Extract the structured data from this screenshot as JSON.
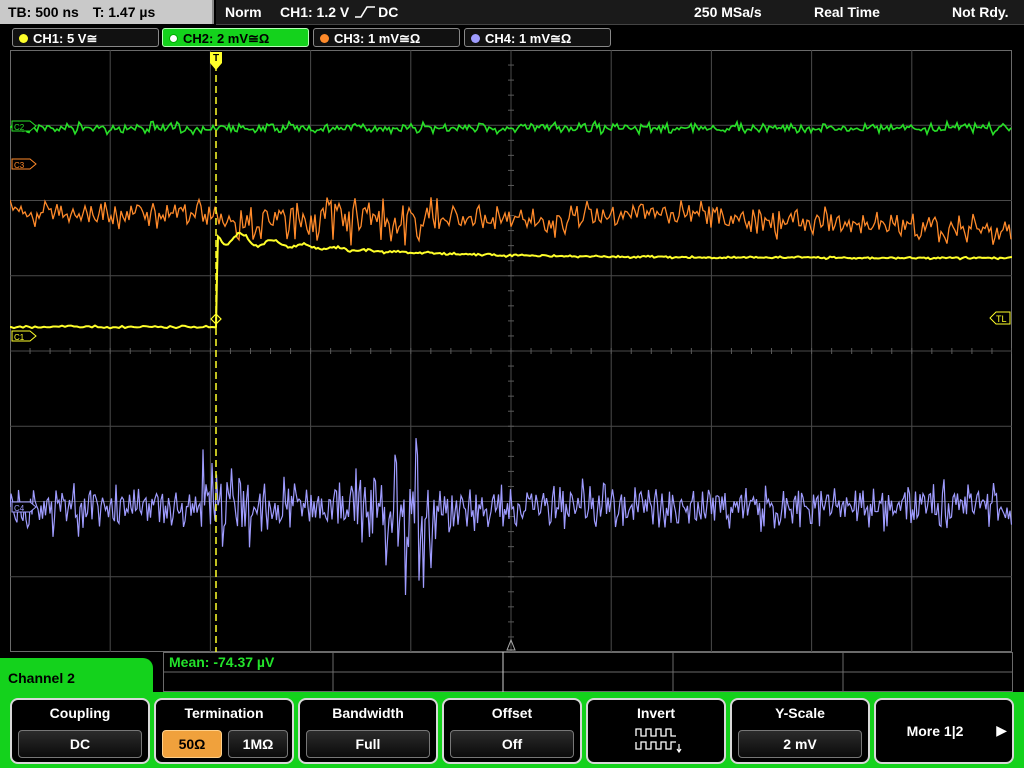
{
  "topbar": {
    "timebase": "TB: 500 ns",
    "trigger_time": "T: 1.47 µs",
    "trigger_mode": "Norm",
    "trigger_source": "CH1: 1.2 V",
    "trigger_coupling": "DC",
    "sample_rate": "250 MSa/s",
    "acq_mode": "Real Time",
    "status": "Not Rdy."
  },
  "channels": [
    {
      "label": "CH1: 5 V≅",
      "color": "#ffff2a"
    },
    {
      "label": "CH2: 2 mV≅Ω",
      "color": "#28e028"
    },
    {
      "label": "CH3: 1 mV≅Ω",
      "color": "#ff8a2a"
    },
    {
      "label": "CH4: 1 mV≅Ω",
      "color": "#9f9cff"
    }
  ],
  "markers": {
    "c2": "C2",
    "c3": "C3",
    "c1": "C1",
    "c4": "C4",
    "trigger_level": "TL",
    "trigger_pos": "T"
  },
  "measurement": {
    "mean": "Mean: -74.37 µV"
  },
  "menu": {
    "title": "Channel 2",
    "coupling": {
      "title": "Coupling",
      "value": "DC"
    },
    "termination": {
      "title": "Termination",
      "opt1": "50Ω",
      "opt2": "1MΩ"
    },
    "bandwidth": {
      "title": "Bandwidth",
      "value": "Full"
    },
    "offset": {
      "title": "Offset",
      "value": "Off"
    },
    "invert": {
      "title": "Invert"
    },
    "yscale": {
      "title": "Y-Scale",
      "value": "2 mV"
    },
    "more": {
      "label": "More 1|2"
    }
  },
  "colors": {
    "menu_accent": "#14d21c",
    "grid": "#5a5a5a"
  }
}
